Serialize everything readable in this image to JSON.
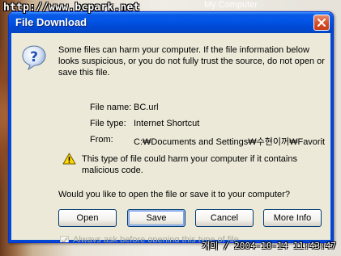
{
  "desktop": {
    "watermark_top": "http://www.bcpark.net",
    "desktop_label": "My Computer",
    "watermark_bottom": "개미 / 2004-10-14 11:43:47"
  },
  "dialog": {
    "title": "File Download",
    "message": "Some files can harm your computer. If the file information below looks suspicious, or you do not fully trust the source, do not open or save this file.",
    "file_name_label": "File name:",
    "file_name_value": "BC.url",
    "file_type_label": "File type:",
    "file_type_value": "Internet Shortcut",
    "from_label": "From:",
    "from_value": "C:₩Documents and Settings₩수현이꺼₩Favorit",
    "warning": "This type of file could harm your computer if it contains malicious code.",
    "question": "Would you like to open the file or save it to your computer?",
    "buttons": {
      "open": "Open",
      "save": "Save",
      "cancel": "Cancel",
      "more_info": "More Info"
    },
    "always_ask": "Always ask before opening this type of file",
    "always_ask_checked": true
  },
  "icons": {
    "question": "question-icon",
    "warning": "warning-icon",
    "close": "close-icon"
  },
  "colors": {
    "titlebar": "#0054e3",
    "dialog_bg": "#ece9d8",
    "close_button": "#d8512c"
  }
}
